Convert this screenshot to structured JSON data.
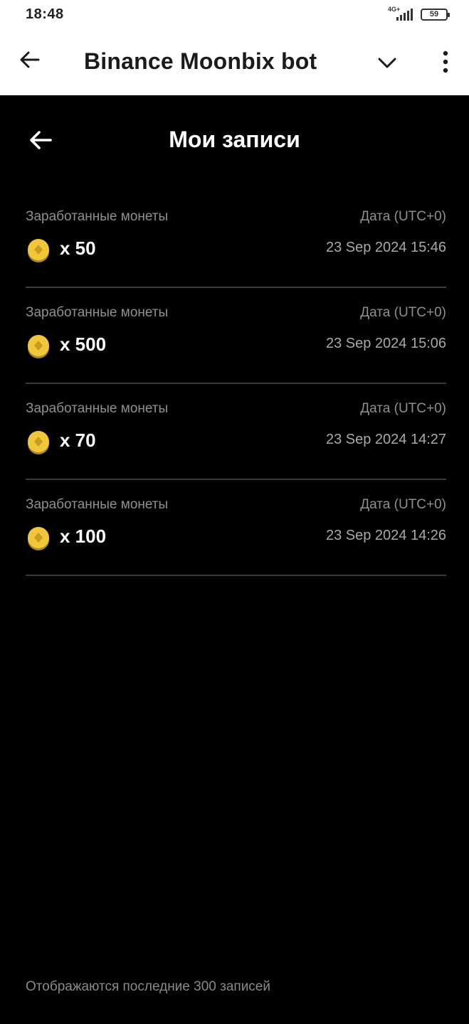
{
  "status_bar": {
    "time": "18:48",
    "network": "4G+",
    "battery": "59",
    "icons": [
      "signal-icon",
      "battery-icon"
    ]
  },
  "header": {
    "title": "Binance Moonbix bot",
    "icons": [
      "arrow-left-icon",
      "chevron-down-icon",
      "more-vertical-icon"
    ]
  },
  "page": {
    "title": "Мои записи",
    "back_icon": "arrow-left-icon"
  },
  "records": [
    {
      "label": "Заработанные монеты",
      "amount": "x 50",
      "date_label": "Дата (UTC+0)",
      "date": "23 Sep 2024 15:46"
    },
    {
      "label": "Заработанные монеты",
      "amount": "x 500",
      "date_label": "Дата (UTC+0)",
      "date": "23 Sep 2024 15:06"
    },
    {
      "label": "Заработанные монеты",
      "amount": "x 70",
      "date_label": "Дата (UTC+0)",
      "date": "23 Sep 2024 14:27"
    },
    {
      "label": "Заработанные монеты",
      "amount": "x 100",
      "date_label": "Дата (UTC+0)",
      "date": "23 Sep 2024 14:26"
    }
  ],
  "footer": {
    "note": "Отображаются последние 300 записей"
  },
  "colors": {
    "background": "#000000",
    "header_background": "#ffffff",
    "coin": "#f0c63b",
    "muted_text": "#8f8f8f",
    "divider": "#3a3a3a"
  }
}
